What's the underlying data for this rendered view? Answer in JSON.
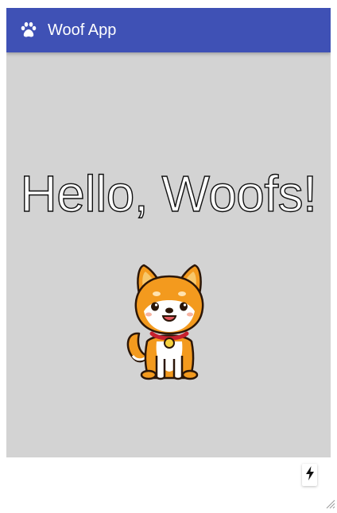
{
  "appbar": {
    "title": "Woof App",
    "icon": "paw-icon",
    "color": "#3f51b5"
  },
  "main": {
    "greeting": "Hello, Woofs!",
    "background": "#d3d3d3",
    "image": "shiba-dog-illustration"
  },
  "floating": {
    "icon": "lightning-bolt-icon"
  }
}
